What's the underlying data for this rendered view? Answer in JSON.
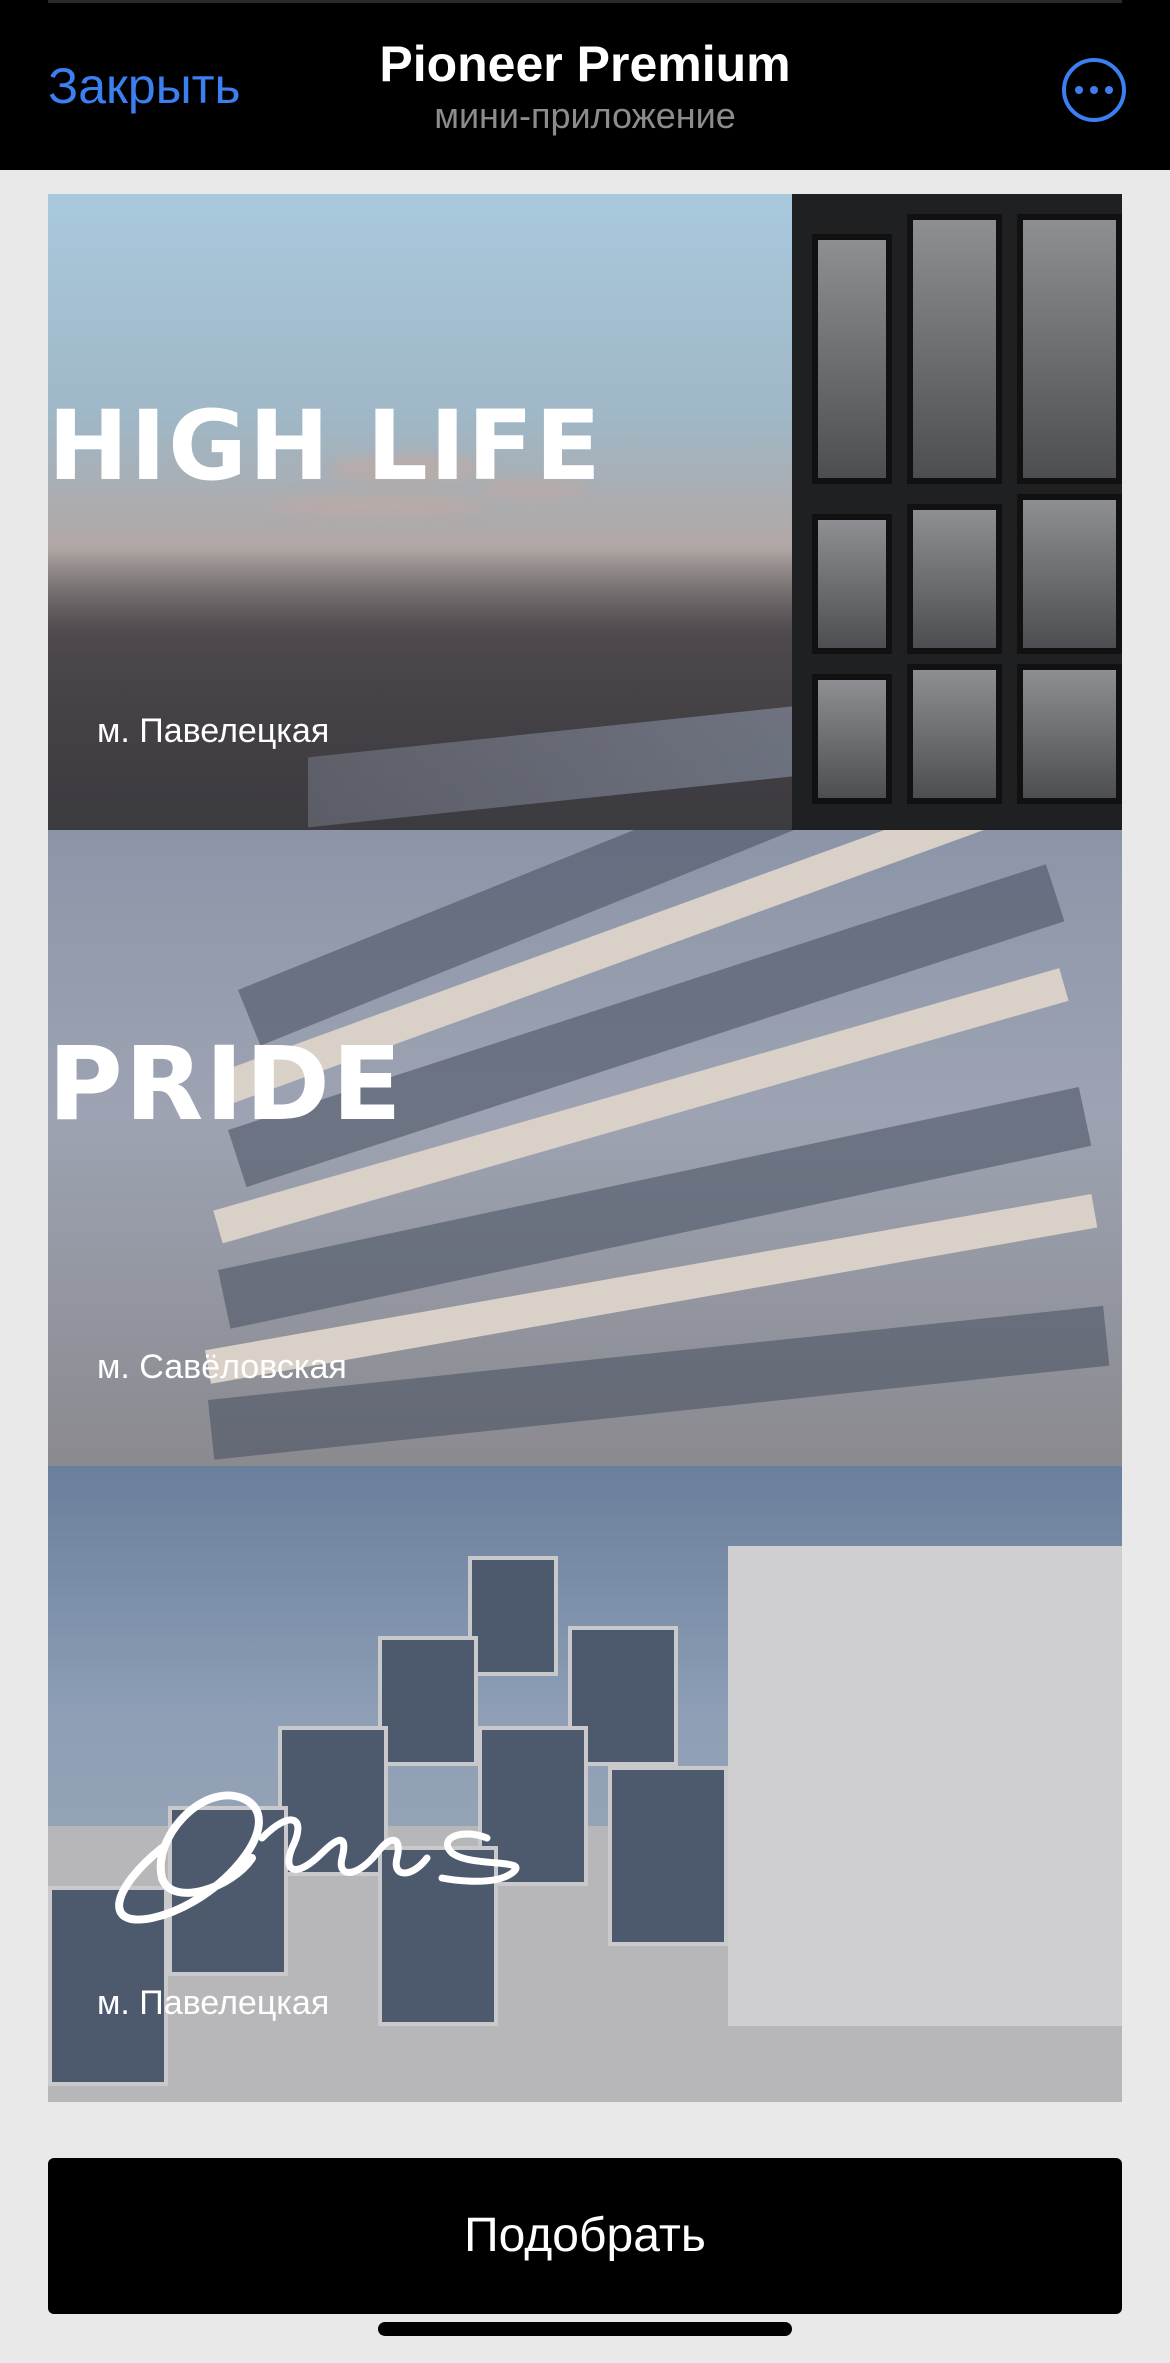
{
  "header": {
    "close_label": "Закрыть",
    "title": "Pioneer Premium",
    "subtitle": "мини-приложение",
    "more_icon": "ellipsis-circle-icon"
  },
  "projects": [
    {
      "name": "HIGH LIFE",
      "metro": "м. Павелецкая"
    },
    {
      "name": "PRIDE",
      "metro": "м. Савёловская"
    },
    {
      "name": "Opus",
      "metro": "м. Павелецкая"
    }
  ],
  "cta": {
    "label": "Подобрать"
  },
  "colors": {
    "accent": "#3b7ff0",
    "header_bg": "#000000",
    "page_bg": "#e9e9e9",
    "cta_bg": "#000000"
  }
}
